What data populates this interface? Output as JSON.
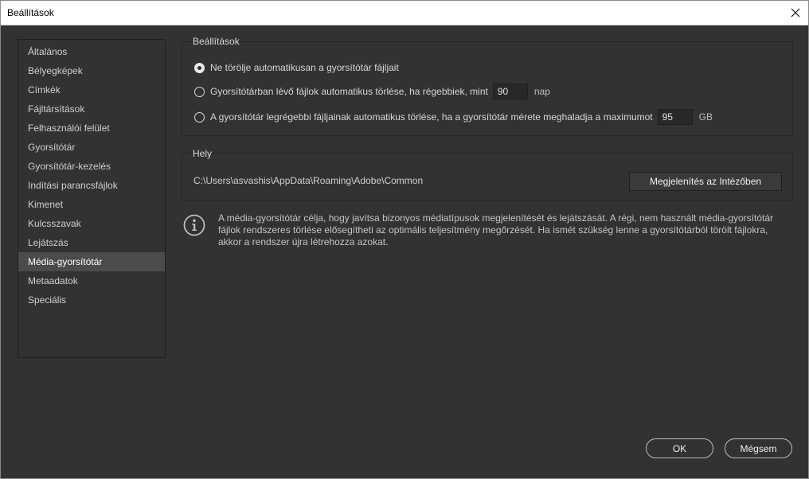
{
  "window": {
    "title": "Beállítások",
    "close_symbol": "✕"
  },
  "sidebar": {
    "items": [
      {
        "label": "Általános"
      },
      {
        "label": "Bélyegképek"
      },
      {
        "label": "Címkék"
      },
      {
        "label": "Fájltársítások"
      },
      {
        "label": "Felhasználói felület"
      },
      {
        "label": "Gyorsítótár"
      },
      {
        "label": "Gyorsítótár-kezelés"
      },
      {
        "label": "Indítási parancsfájlok"
      },
      {
        "label": "Kimenet"
      },
      {
        "label": "Kulcsszavak"
      },
      {
        "label": "Lejátszás"
      },
      {
        "label": "Média-gyorsítótár",
        "selected": true
      },
      {
        "label": "Metaadatok"
      },
      {
        "label": "Speciális"
      }
    ]
  },
  "settings_group": {
    "label": "Beállítások",
    "options": [
      {
        "label": "Ne törölje automatikusan a gyorsítótár fájljait",
        "checked": true
      },
      {
        "label": "Gyorsítótárban lévő fájlok automatikus törlése, ha régebbiek, mint",
        "value": "90",
        "unit": "nap",
        "checked": false
      },
      {
        "label": "A gyorsítótár legrégebbi fájljainak automatikus törlése, ha a gyorsítótár mérete meghaladja a maximumot",
        "value": "95",
        "unit": "GB",
        "checked": false
      }
    ]
  },
  "location_group": {
    "label": "Hely",
    "path": "C:\\Users\\asvashis\\AppData\\Roaming\\Adobe\\Common",
    "reveal_button": "Megjelenítés az Intézőben"
  },
  "info": {
    "icon": "info-icon",
    "text": "A média-gyorsítótár célja, hogy javítsa bizonyos médiatípusok megjelenítését és lejátszását. A régi, nem használt média-gyorsítótár fájlok rendszeres törlése elősegítheti az optimális teljesítmény megőrzését. Ha ismét szükség lenne a gyorsítótárból törölt fájlokra, akkor a rendszer újra létrehozza azokat."
  },
  "footer": {
    "ok_label": "OK",
    "cancel_label": "Mégsem"
  },
  "colors": {
    "background": "#323232",
    "selected_item": "#4b4b4b",
    "titlebar": "#ffffff"
  }
}
